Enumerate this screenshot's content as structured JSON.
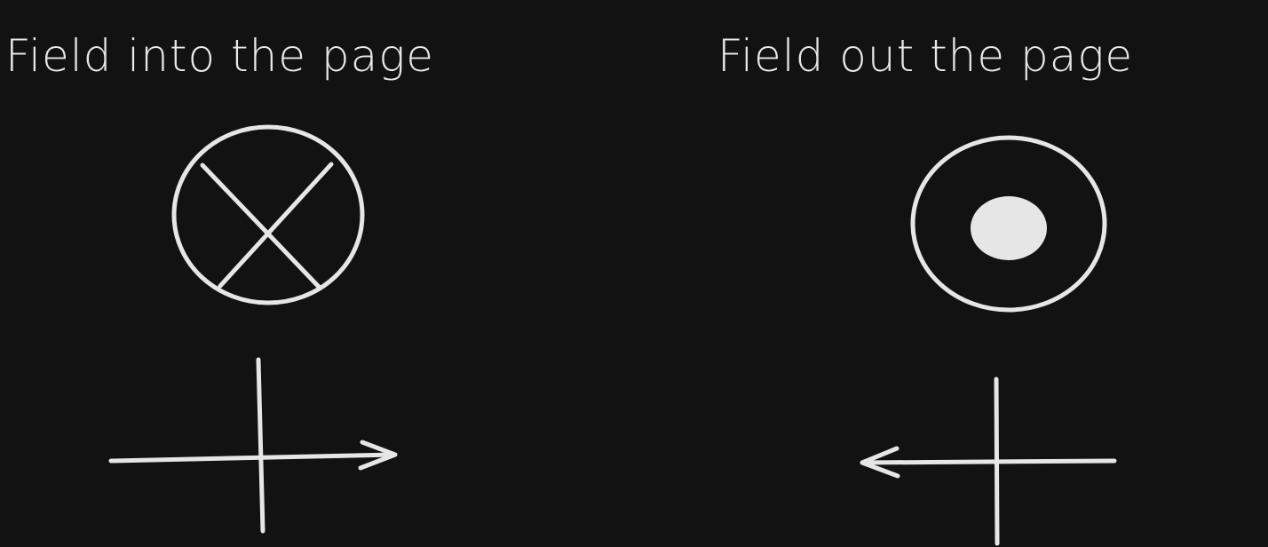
{
  "panels": {
    "left": {
      "title": "Field into the page",
      "symbol_icon": "cross-in-circle-icon",
      "axes_icon": "axes-arrow-right-icon"
    },
    "right": {
      "title": "Field out the page",
      "symbol_icon": "dot-in-circle-icon",
      "axes_icon": "axes-arrow-left-icon"
    }
  },
  "colors": {
    "background": "#121212",
    "stroke": "#e6e6e6"
  }
}
